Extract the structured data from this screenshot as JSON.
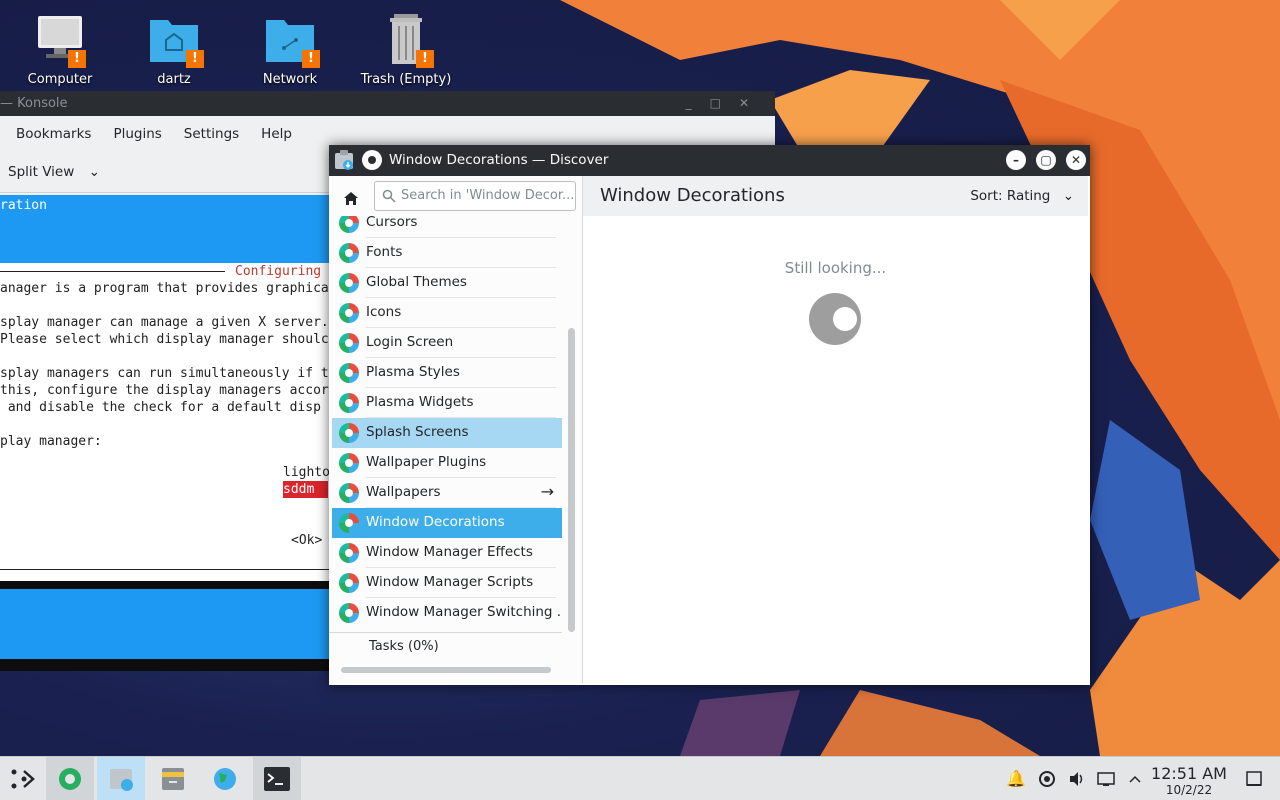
{
  "desktop": {
    "icons": [
      {
        "label": "Computer"
      },
      {
        "label": "dartz"
      },
      {
        "label": "Network"
      },
      {
        "label": "Trash (Empty)"
      }
    ]
  },
  "konsole": {
    "title": "— Konsole",
    "menu": [
      "Bookmarks",
      "Plugins",
      "Settings",
      "Help"
    ],
    "toolbar": {
      "split_view": "Split View"
    },
    "term": {
      "top_line": "ration",
      "dialog_title": "Configuring",
      "lines": [
        "anager is a program that provides graphica",
        "",
        "splay manager can manage a given X server.",
        "Please select which display manager shoulc",
        "",
        "splay managers can run simultaneously if t",
        "this, configure the display managers accor",
        " and disable the check for a default disp",
        "",
        "play manager:"
      ],
      "option1": "lighto",
      "option2": "sddm",
      "ok": "<Ok>"
    }
  },
  "discover": {
    "title": "Window Decorations — Discover",
    "search_placeholder": "Search in 'Window Decor...",
    "page_title": "Window Decorations",
    "sort": "Sort: Rating",
    "categories": [
      {
        "label": "Cursors"
      },
      {
        "label": "Fonts"
      },
      {
        "label": "Global Themes"
      },
      {
        "label": "Icons"
      },
      {
        "label": "Login Screen"
      },
      {
        "label": "Plasma Styles"
      },
      {
        "label": "Plasma Widgets"
      },
      {
        "label": "Splash Screens"
      },
      {
        "label": "Wallpaper Plugins"
      },
      {
        "label": "Wallpapers"
      },
      {
        "label": "Window Decorations"
      },
      {
        "label": "Window Manager Effects"
      },
      {
        "label": "Window Manager Scripts"
      },
      {
        "label": "Window Manager Switching ..."
      }
    ],
    "tasks": "Tasks (0%)",
    "status": "Still looking..."
  },
  "taskbar": {
    "time": "12:51 AM",
    "date": "10/2/22"
  },
  "colors": {
    "accent": "#3daee9",
    "hover": "#a6d7f3",
    "warning": "#f67400",
    "titlebar": "#2a2e32"
  }
}
